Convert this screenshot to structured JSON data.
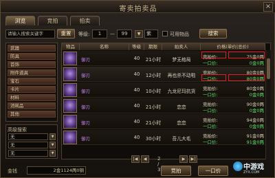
{
  "window": {
    "title": "寄卖拍卖品",
    "close": "×"
  },
  "tabs": [
    {
      "label": "浏览"
    },
    {
      "label": "竞拍"
    },
    {
      "label": "拍卖"
    }
  ],
  "search": {
    "keyword_placeholder": "请输入搜索关键字",
    "reset": "重置",
    "level_label": "等级:",
    "level_min": "1",
    "level_sep": "—",
    "level_max": "99",
    "quality": "紫",
    "usable_label": "可用物品",
    "search_button": "搜索"
  },
  "categories": [
    {
      "label": "武器"
    },
    {
      "label": "防具"
    },
    {
      "label": "首饰"
    },
    {
      "label": "附件道具"
    },
    {
      "label": "宝石"
    },
    {
      "label": "卡片"
    },
    {
      "label": "材料"
    },
    {
      "label": "消耗品"
    },
    {
      "label": "其他"
    }
  ],
  "advanced": {
    "title": "高级搜索",
    "selects": [
      {
        "value": "无"
      },
      {
        "value": "无"
      },
      {
        "value": "无"
      }
    ]
  },
  "table": {
    "headers": [
      "物品",
      "名称",
      "等级",
      "期限",
      "拍卖人",
      "价格(单价|总价)"
    ],
    "rows": [
      {
        "name": "御刃",
        "level": "40",
        "time": "21小时",
        "seller": "梦无格局",
        "bid_label": "竞拍价:",
        "bid": "75金0两",
        "buy_label": "一口价:",
        "buy": "0金0两"
      },
      {
        "name": "御刃",
        "level": "40",
        "time": "12小时",
        "seller": "再也杀不动啦",
        "bid_label": "竞拍价:",
        "bid": "80金0两",
        "buy_label": "一口价:",
        "buy": "80金0两"
      },
      {
        "name": "御刃",
        "level": "40",
        "time": "10小时",
        "seller": "九龙尼玛抗货",
        "bid_label": "竞拍价:",
        "bid": "80金0两",
        "buy_label": "一口价:",
        "buy": "0金0两"
      },
      {
        "name": "御刃",
        "level": "40",
        "time": "21小时",
        "seller": "恋恋",
        "bid_label": "竞拍价:",
        "bid": "90金0两",
        "buy_label": "一口价:",
        "buy": "0金0两"
      },
      {
        "name": "御刃",
        "level": "40",
        "time": "21小时",
        "seller": "恋恋",
        "bid_label": "竞拍价:",
        "bid": "94金0两",
        "buy_label": "一口价:",
        "buy": "0金0两"
      },
      {
        "name": "御刃",
        "level": "40",
        "time": "30小时",
        "seller": "吾儿大毛",
        "bid_label": "竞拍价:",
        "bid": "91金0两",
        "buy_label": "一口价:",
        "buy": "91金0两"
      }
    ]
  },
  "pager": {
    "first": "|◀",
    "prev": "◀",
    "text": "2 / 38",
    "next": "▶",
    "last": "▶|"
  },
  "bottom": {
    "money_label": "金钱",
    "money": "2金1124两0铜",
    "bid_button": "竞拍",
    "buyout_button": "一口价"
  },
  "watermark": {
    "text": "中游戏",
    "sub": "ZYX.COM"
  }
}
